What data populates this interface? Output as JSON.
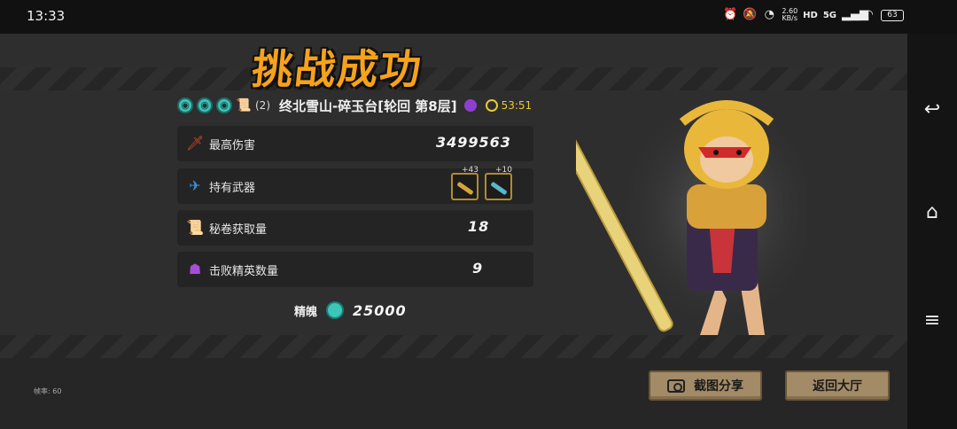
{
  "status_bar": {
    "time": "13:33",
    "net_speed_value": "2.60",
    "net_speed_unit": "KB/s",
    "network": "5G",
    "hd": "HD",
    "battery": "63"
  },
  "result": {
    "title": "挑战成功",
    "stage": "终北雪山-碎玉台[轮回 第8层]",
    "scroll_count": "(2)",
    "time": "53:51"
  },
  "stats": [
    {
      "label": "最高伤害",
      "value": "3499563",
      "icon": "dagger-icon"
    },
    {
      "label": "持有武器",
      "value": "",
      "icon": "weapon-icon"
    },
    {
      "label": "秘卷获取量",
      "value": "18",
      "icon": "scroll-icon"
    },
    {
      "label": "击败精英数量",
      "value": "9",
      "icon": "elite-icon"
    }
  ],
  "weapons": [
    {
      "level": "+43",
      "color": "#d4a43a"
    },
    {
      "level": "+10",
      "color": "#5ab7c9"
    }
  ],
  "soul": {
    "label": "精魄",
    "value": "25000"
  },
  "buttons": {
    "share": "截图分享",
    "back": "返回大厅"
  },
  "fps": "帧率: 60",
  "colors": {
    "title": "#f7a21b",
    "button": "#a38b67",
    "gem": "#3bc6b8",
    "accent": "#e8c933"
  }
}
